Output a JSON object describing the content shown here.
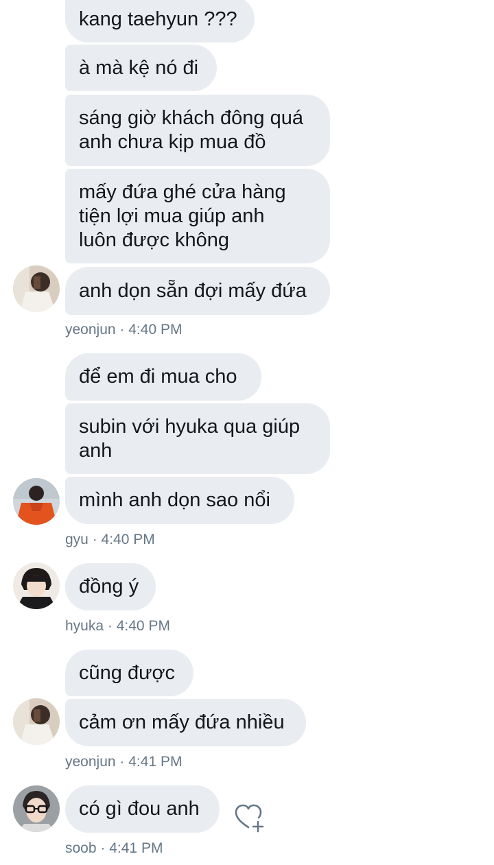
{
  "groups": [
    {
      "sender": "yeonjun",
      "time": "4:40 PM",
      "messages": [
        "kang taehyun ???",
        "à mà kệ nó đi",
        "sáng giờ khách đông quá\nanh chưa kịp mua đồ",
        "mấy đứa ghé cửa hàng\ntiện lợi mua giúp anh\nluôn được không",
        "anh dọn sẵn đợi mấy đứa"
      ]
    },
    {
      "sender": "gyu",
      "time": "4:40 PM",
      "messages": [
        "để em đi mua cho",
        "subin với hyuka qua giúp\nanh",
        "mình anh dọn sao nổi"
      ]
    },
    {
      "sender": "hyuka",
      "time": "4:40 PM",
      "messages": [
        "đồng ý"
      ]
    },
    {
      "sender": "yeonjun",
      "time": "4:41 PM",
      "messages": [
        "cũng được",
        "cảm ơn mấy đứa nhiều"
      ]
    },
    {
      "sender": "soob",
      "time": "4:41 PM",
      "messages": [
        "có gì đou anh"
      ]
    }
  ],
  "meta_separator": "·",
  "icons": {
    "react": "heart-plus-icon",
    "avatar_yeonjun": "avatar-photo-yeonjun",
    "avatar_gyu": "avatar-photo-gyu",
    "avatar_hyuka": "avatar-photo-hyuka",
    "avatar_soob": "avatar-photo-soob"
  },
  "colors": {
    "bubble": "#e9edf1",
    "meta_text": "#657786",
    "message_text": "#14171a"
  }
}
